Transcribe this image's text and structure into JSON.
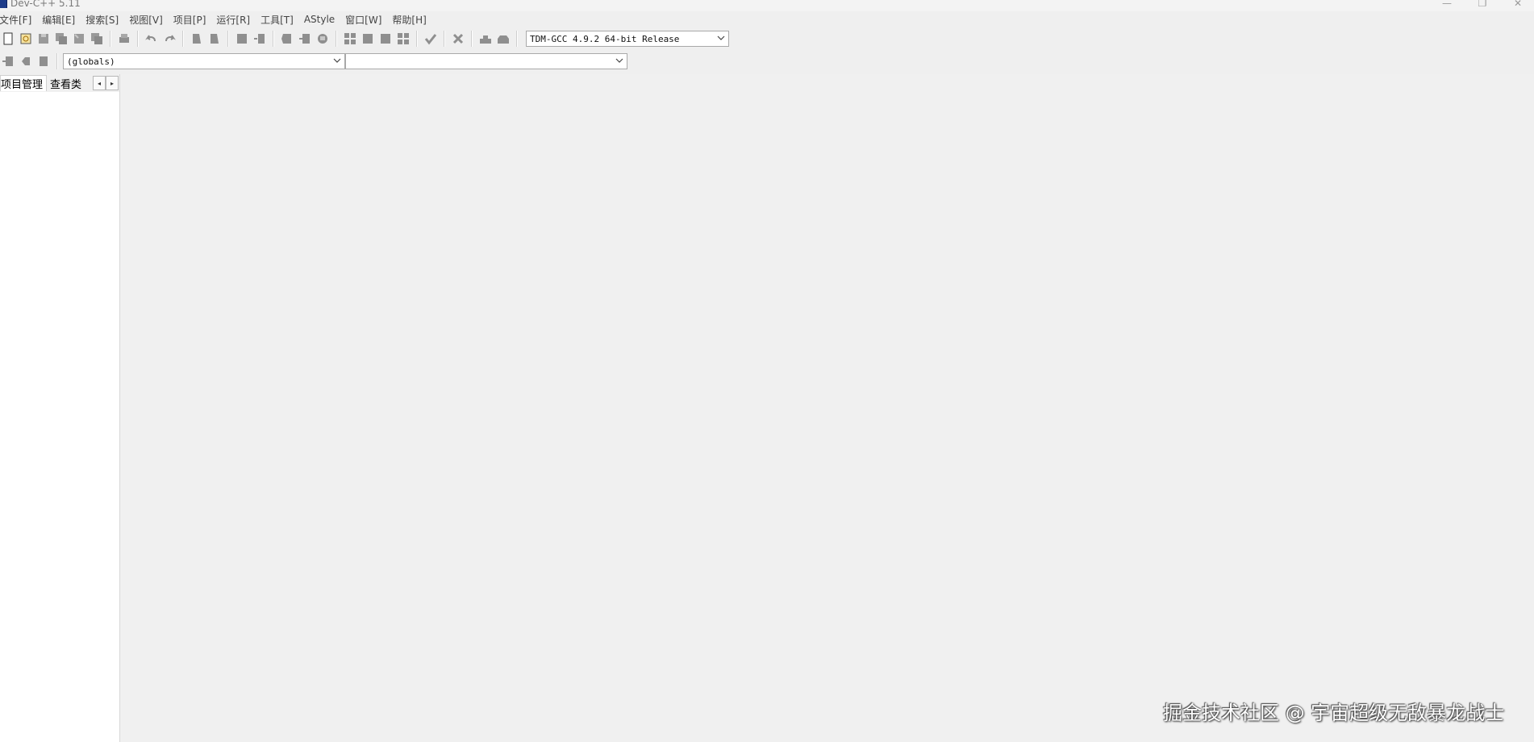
{
  "window": {
    "title": "Dev-C++ 5.11",
    "minimize_glyph": "—",
    "maximize_glyph": "❐",
    "close_glyph": "✕"
  },
  "menu": [
    "文件[F]",
    "编辑[E]",
    "搜索[S]",
    "视图[V]",
    "项目[P]",
    "运行[R]",
    "工具[T]",
    "AStyle",
    "窗口[W]",
    "帮助[H]"
  ],
  "toolbar": {
    "compiler_selected": "TDM-GCC 4.9.2 64-bit Release",
    "class_combo_value": "(globals)",
    "member_combo_value": ""
  },
  "left_panel": {
    "tabs": [
      "项目管理",
      "查看类"
    ],
    "active_tab": "项目管理",
    "scroll_left": "◂",
    "scroll_right": "▸"
  },
  "watermark": "掘金技术社区 @ 宇宙超级无敌暴龙战士",
  "colors": {
    "background": "#efefef",
    "panel": "#ffffff",
    "icon_gray": "#8b8b8b"
  }
}
